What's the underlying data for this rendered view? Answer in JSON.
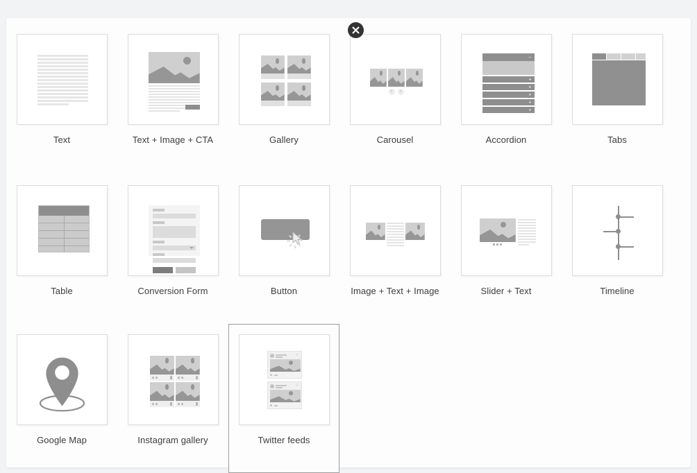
{
  "dialog": {
    "name": "block-type-picker",
    "close_label": "×",
    "close_icon": "close-icon",
    "background_color": "#f2f3f5",
    "panel_color": "#fdfdfd",
    "selected_border_color": "#9b9b9b"
  },
  "rows": [
    {
      "index": 1,
      "items": [
        {
          "label": "Text",
          "thumb": "text",
          "selected": false
        },
        {
          "label": "Text + Image + CTA",
          "thumb": "text-image-cta",
          "selected": false
        },
        {
          "label": "Gallery",
          "thumb": "gallery",
          "selected": false
        },
        {
          "label": "Carousel",
          "thumb": "carousel",
          "selected": false
        },
        {
          "label": "Accordion",
          "thumb": "accordion",
          "selected": false
        },
        {
          "label": "Tabs",
          "thumb": "tabs",
          "selected": false
        }
      ]
    },
    {
      "index": 2,
      "items": [
        {
          "label": "Table",
          "thumb": "table",
          "selected": false
        },
        {
          "label": "Conversion Form",
          "thumb": "conversion-form",
          "selected": false
        },
        {
          "label": "Button",
          "thumb": "button",
          "selected": false
        },
        {
          "label": "Image + Text + Image",
          "thumb": "image-text-image",
          "selected": false
        },
        {
          "label": "Slider + Text",
          "thumb": "slider-text",
          "selected": false
        },
        {
          "label": "Timeline",
          "thumb": "timeline",
          "selected": false
        }
      ]
    },
    {
      "index": 3,
      "items": [
        {
          "label": "Google Map",
          "thumb": "google-map",
          "selected": false
        },
        {
          "label": "Instagram gallery",
          "thumb": "instagram-gallery",
          "selected": false
        },
        {
          "label": "Twitter feeds",
          "thumb": "twitter-feeds",
          "selected": true
        }
      ]
    }
  ],
  "thumb_details": {
    "carousel": {
      "prev_arrow": "‹",
      "next_arrow": "›"
    },
    "accordion": {
      "open_sign": "–",
      "closed_sign": "+",
      "closed_count": 5
    },
    "tabs": {
      "tab_count": 4,
      "active_tab_index": 0
    },
    "gallery": {
      "tile_count": 4
    },
    "instagram_gallery": {
      "tile_count": 4
    },
    "twitter_feeds": {
      "card_count": 2
    },
    "timeline": {
      "node_count": 3
    },
    "table": {
      "rows": 5,
      "columns": 2
    },
    "text": {
      "line_count": 15
    }
  }
}
